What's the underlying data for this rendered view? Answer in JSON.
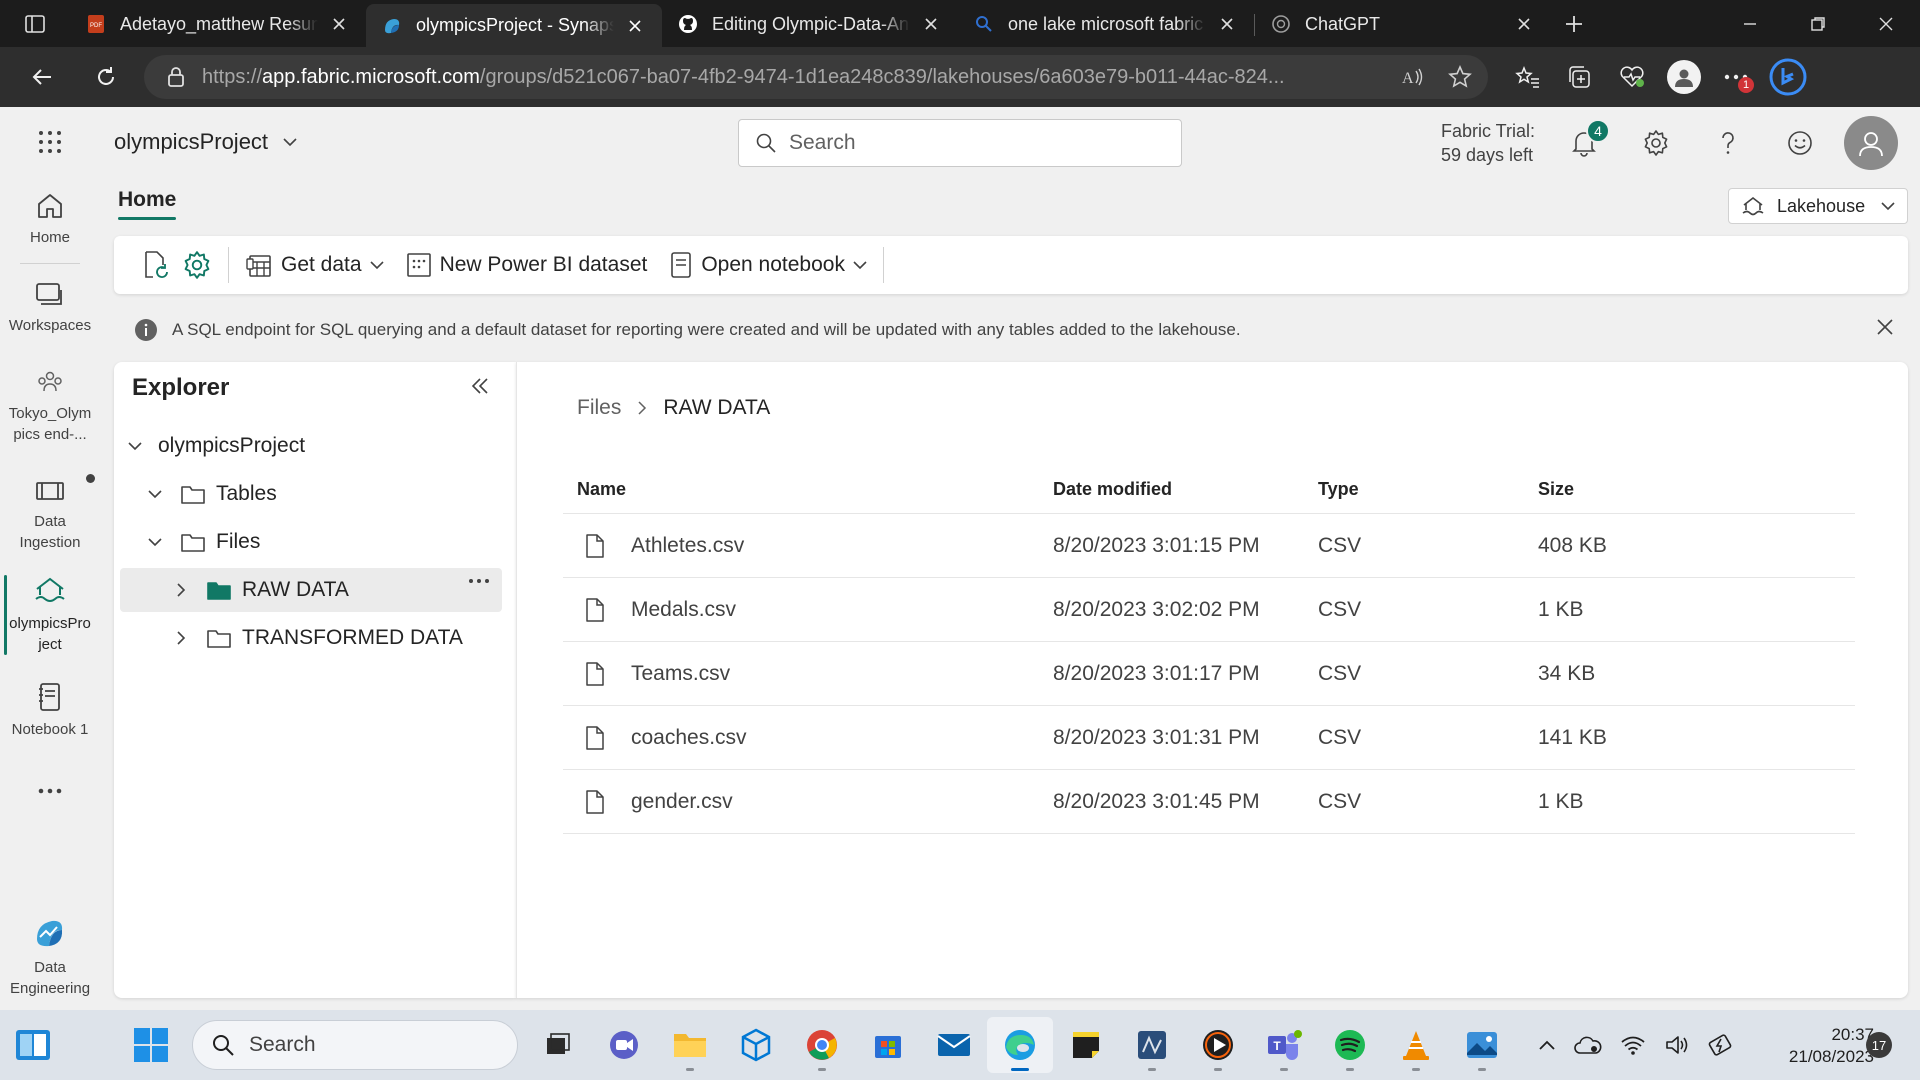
{
  "browser": {
    "tabs": [
      {
        "title": "Adetayo_matthew Resume",
        "icon": "pdf-icon",
        "active": false
      },
      {
        "title": "olympicsProject - Synapse",
        "icon": "fabric-icon",
        "active": true
      },
      {
        "title": "Editing Olympic-Data-Ana",
        "icon": "github-icon",
        "active": false
      },
      {
        "title": "one lake microsoft fabric",
        "icon": "search-icon",
        "active": false
      },
      {
        "title": "ChatGPT",
        "icon": "chatgpt-icon",
        "active": false
      }
    ],
    "url_prefix": "https://",
    "url_host": "app.fabric.microsoft.com",
    "url_path": "/groups/d521c067-ba07-4fb2-9474-1d1ea248c839/lakehouses/6a603e79-b011-44ac-824...",
    "extension_badge": "1"
  },
  "header": {
    "workspace_name": "olympicsProject",
    "search_placeholder": "Search",
    "trial_line1": "Fabric Trial:",
    "trial_line2": "59 days left",
    "notification_count": "4"
  },
  "rail": {
    "items": [
      {
        "label": "Home",
        "icon": "home-icon"
      },
      {
        "label": "Workspaces",
        "icon": "workspaces-icon"
      },
      {
        "label": "Tokyo_Olympics end-...",
        "icon": "workspace-group-icon"
      },
      {
        "label": "Data Ingestion",
        "icon": "pipeline-icon"
      },
      {
        "label": "olympicsProject",
        "icon": "lakehouse-icon"
      },
      {
        "label": "Notebook 1",
        "icon": "notebook-icon"
      }
    ],
    "label_tokyo_1": "Tokyo_Olym",
    "label_tokyo_2": "pics end-...",
    "label_ingest_1": "Data",
    "label_ingest_2": "Ingestion",
    "label_proj_1": "olympicsPro",
    "label_proj_2": "ject",
    "footer_1": "Data",
    "footer_2": "Engineering"
  },
  "ribbon": {
    "tab": "Home",
    "mode": "Lakehouse",
    "get_data": "Get data",
    "new_dataset": "New Power BI dataset",
    "open_notebook": "Open notebook"
  },
  "info": {
    "message": "A SQL endpoint for SQL querying and a default dataset for reporting were created and will be updated with any tables added to the lakehouse."
  },
  "explorer": {
    "title": "Explorer",
    "root": "olympicsProject",
    "tables": "Tables",
    "files": "Files",
    "raw": "RAW DATA",
    "transformed": "TRANSFORMED DATA"
  },
  "content": {
    "breadcrumb": [
      "Files",
      "RAW DATA"
    ],
    "columns": [
      "Name",
      "Date modified",
      "Type",
      "Size"
    ],
    "rows": [
      {
        "name": "Athletes.csv",
        "date": "8/20/2023 3:01:15 PM",
        "type": "CSV",
        "size": "408 KB"
      },
      {
        "name": "Medals.csv",
        "date": "8/20/2023 3:02:02 PM",
        "type": "CSV",
        "size": "1 KB"
      },
      {
        "name": "Teams.csv",
        "date": "8/20/2023 3:01:17 PM",
        "type": "CSV",
        "size": "34 KB"
      },
      {
        "name": "coaches.csv",
        "date": "8/20/2023 3:01:31 PM",
        "type": "CSV",
        "size": "141 KB"
      },
      {
        "name": "gender.csv",
        "date": "8/20/2023 3:01:45 PM",
        "type": "CSV",
        "size": "1 KB"
      }
    ]
  },
  "taskbar": {
    "search": "Search",
    "time": "20:37",
    "date": "21/08/2023",
    "notifications": "17"
  },
  "colors": {
    "accent": "#117865",
    "edge_blue": "#0067c0"
  }
}
